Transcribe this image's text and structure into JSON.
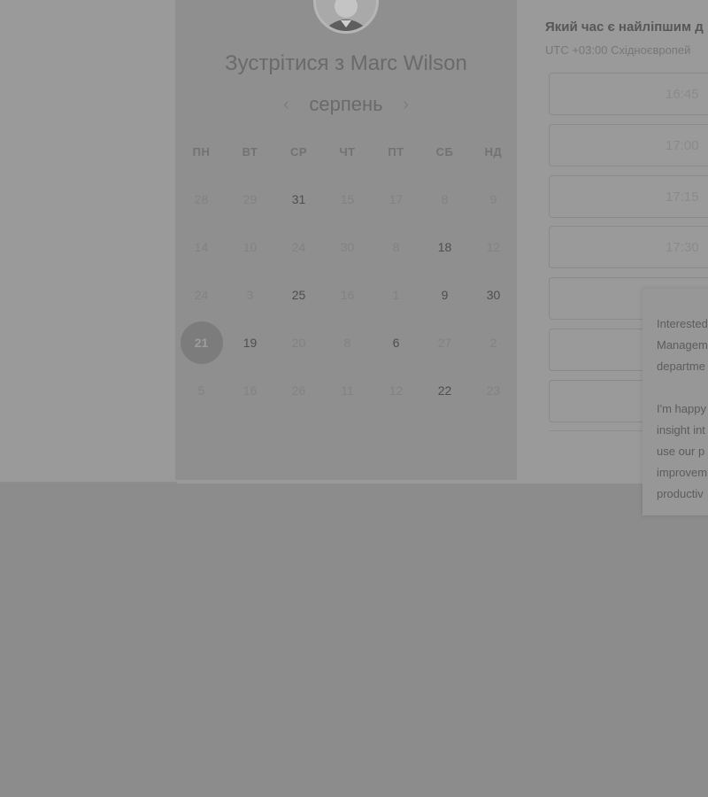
{
  "header": {
    "title": "Зустрітися з Marc Wilson"
  },
  "calendar": {
    "month": "серпень",
    "weekdays": [
      "ПН",
      "ВТ",
      "СР",
      "ЧТ",
      "ПТ",
      "СБ",
      "НД"
    ],
    "days": [
      {
        "label": "28",
        "available": false,
        "selected": false
      },
      {
        "label": "29",
        "available": false,
        "selected": false
      },
      {
        "label": "31",
        "available": true,
        "selected": false
      },
      {
        "label": "15",
        "available": false,
        "selected": false
      },
      {
        "label": "17",
        "available": false,
        "selected": false
      },
      {
        "label": "8",
        "available": false,
        "selected": false
      },
      {
        "label": "9",
        "available": false,
        "selected": false
      },
      {
        "label": "14",
        "available": false,
        "selected": false
      },
      {
        "label": "10",
        "available": false,
        "selected": false
      },
      {
        "label": "24",
        "available": false,
        "selected": false
      },
      {
        "label": "30",
        "available": false,
        "selected": false
      },
      {
        "label": "8",
        "available": false,
        "selected": false
      },
      {
        "label": "18",
        "available": true,
        "selected": false
      },
      {
        "label": "12",
        "available": false,
        "selected": false
      },
      {
        "label": "24",
        "available": false,
        "selected": false
      },
      {
        "label": "3",
        "available": false,
        "selected": false
      },
      {
        "label": "25",
        "available": true,
        "selected": false
      },
      {
        "label": "16",
        "available": false,
        "selected": false
      },
      {
        "label": "1",
        "available": false,
        "selected": false
      },
      {
        "label": "9",
        "available": true,
        "selected": false
      },
      {
        "label": "30",
        "available": true,
        "selected": false
      },
      {
        "label": "21",
        "available": true,
        "selected": true
      },
      {
        "label": "19",
        "available": true,
        "selected": false
      },
      {
        "label": "20",
        "available": false,
        "selected": false
      },
      {
        "label": "8",
        "available": false,
        "selected": false
      },
      {
        "label": "6",
        "available": true,
        "selected": false
      },
      {
        "label": "27",
        "available": false,
        "selected": false
      },
      {
        "label": "2",
        "available": false,
        "selected": false
      },
      {
        "label": "5",
        "available": false,
        "selected": false
      },
      {
        "label": "16",
        "available": false,
        "selected": false
      },
      {
        "label": "26",
        "available": false,
        "selected": false
      },
      {
        "label": "11",
        "available": false,
        "selected": false
      },
      {
        "label": "12",
        "available": false,
        "selected": false
      },
      {
        "label": "22",
        "available": true,
        "selected": false
      },
      {
        "label": "23",
        "available": false,
        "selected": false
      }
    ]
  },
  "times": {
    "heading": "Який час є найліпшим д",
    "timezone": "UTC +03:00 Східноєвропей",
    "slots": [
      "16:45",
      "17:00",
      "17:15",
      "17:30",
      "",
      "",
      ""
    ]
  },
  "tooltip": {
    "lines": [
      "Interested",
      "Managem",
      "departme",
      "",
      "I'm happy",
      "insight int",
      "use our p",
      "improvem",
      "productiv"
    ]
  }
}
